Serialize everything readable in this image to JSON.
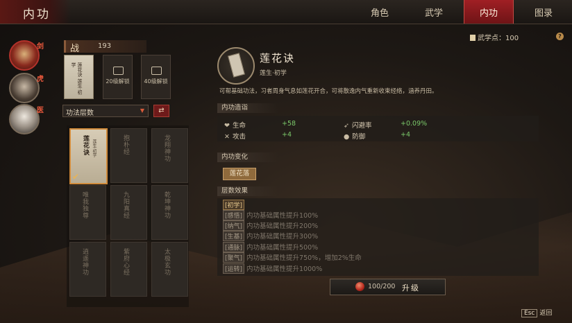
{
  "header": {
    "title": "内功",
    "tabs": [
      {
        "label": "角色",
        "active": false
      },
      {
        "label": "武学",
        "active": false
      },
      {
        "label": "内功",
        "active": true
      },
      {
        "label": "图录",
        "active": false
      }
    ]
  },
  "wuxue_points": "武学点：100",
  "help": "?",
  "characters": [
    {
      "badge": "剑",
      "icon": "hero-portrait-icon"
    },
    {
      "badge": "虎",
      "icon": "bearded-man-portrait-icon"
    },
    {
      "badge": "医",
      "icon": "white-hair-portrait-icon"
    }
  ],
  "left": {
    "combat_label": "战",
    "combat_value": "193",
    "slots": [
      {
        "text": "莲花诀 莲生·初学"
      },
      {
        "text": "20级解锁"
      },
      {
        "text": "40级解锁"
      }
    ],
    "sort_label": "功法层数",
    "swap_icon": "⇄",
    "books": [
      {
        "name": "莲花诀",
        "sub": "莲生·初学",
        "active": true
      },
      {
        "name": "抱朴经",
        "sub": "",
        "active": false
      },
      {
        "name": "龙翔神功",
        "sub": "",
        "active": false
      },
      {
        "name": "唯我独尊",
        "sub": "",
        "active": false
      },
      {
        "name": "九阳真经",
        "sub": "",
        "active": false
      },
      {
        "name": "乾坤神功",
        "sub": "",
        "active": false
      },
      {
        "name": "逍遥神功",
        "sub": "",
        "active": false
      },
      {
        "name": "紫府心经",
        "sub": "",
        "active": false
      },
      {
        "name": "太极玄功",
        "sub": "",
        "active": false
      }
    ]
  },
  "detail": {
    "name": "莲花诀",
    "sub": "莲生·初学",
    "description": "可帮基础功法，习者周身气息如莲花开合，可将散逸内气重新收束经络，涵养丹田。",
    "sec_attr": "内功造诣",
    "stats": [
      {
        "icon": "❤",
        "label": "生命",
        "value": "+58"
      },
      {
        "icon": "➶",
        "label": "闪避率",
        "value": "+0.09%"
      },
      {
        "icon": "✕",
        "label": "攻击",
        "value": "+4"
      },
      {
        "icon": "●",
        "label": "防御",
        "value": "+4"
      }
    ],
    "sec_change": "内功变化",
    "change_tag": "莲花落",
    "sec_levels": "层数效果",
    "levels": [
      {
        "tag": "[初学]",
        "text": ""
      },
      {
        "tag": "[感悟]",
        "text": "内功基础属性提升100%"
      },
      {
        "tag": "[纳气]",
        "text": "内功基础属性提升200%"
      },
      {
        "tag": "[生基]",
        "text": "内功基础属性提升300%"
      },
      {
        "tag": "[通脉]",
        "text": "内功基础属性提升500%"
      },
      {
        "tag": "[聚气]",
        "text": "内功基础属性提升750%，增加2%生命"
      },
      {
        "tag": "[运转]",
        "text": "内功基础属性提升1000%"
      }
    ],
    "upgrade": {
      "count": "100/200",
      "label": "升级"
    }
  },
  "footer": {
    "key": "Esc",
    "label": "返回"
  }
}
